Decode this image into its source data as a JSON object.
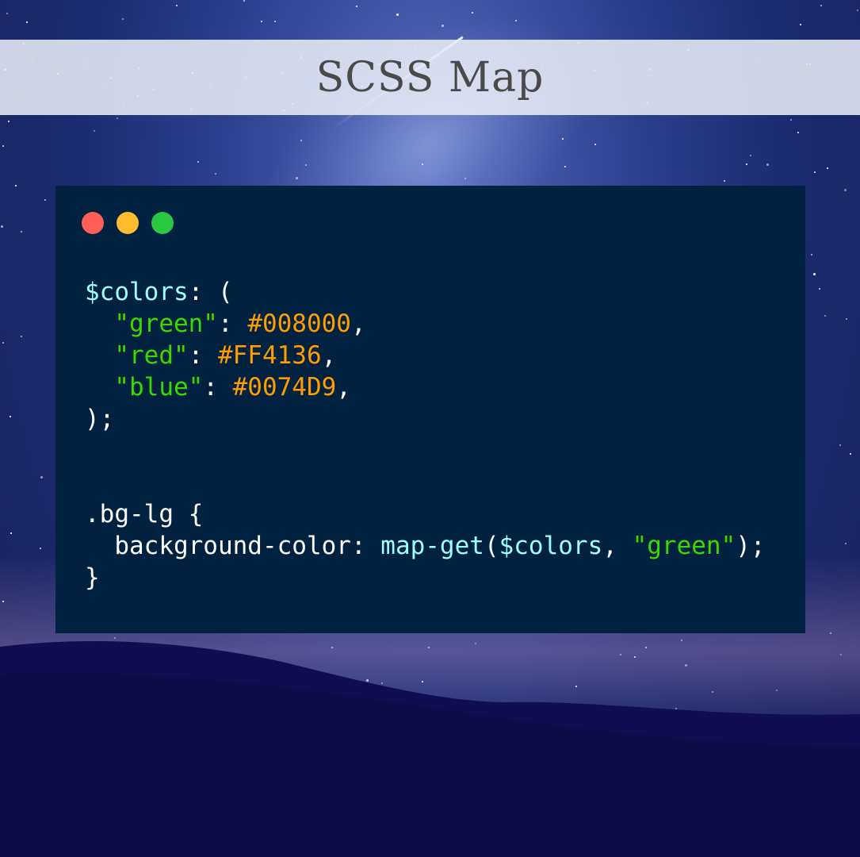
{
  "title": "SCSS Map",
  "window_controls": {
    "close_color": "#ff5f57",
    "minimize_color": "#febc2e",
    "maximize_color": "#28c840"
  },
  "colors": {
    "code_bg": "#002240",
    "plain": "#ffffff",
    "variable": "#9effff",
    "string": "#3ad900",
    "value": "#ff9d00"
  },
  "code_lines": [
    [
      {
        "t": "$colors",
        "c": "variable"
      },
      {
        "t": ": (",
        "c": "plain"
      }
    ],
    [
      {
        "t": "  ",
        "c": "plain"
      },
      {
        "t": "\"green\"",
        "c": "string"
      },
      {
        "t": ": ",
        "c": "plain"
      },
      {
        "t": "#008000",
        "c": "value"
      },
      {
        "t": ",",
        "c": "plain"
      }
    ],
    [
      {
        "t": "  ",
        "c": "plain"
      },
      {
        "t": "\"red\"",
        "c": "string"
      },
      {
        "t": ": ",
        "c": "plain"
      },
      {
        "t": "#FF4136",
        "c": "value"
      },
      {
        "t": ",",
        "c": "plain"
      }
    ],
    [
      {
        "t": "  ",
        "c": "plain"
      },
      {
        "t": "\"blue\"",
        "c": "string"
      },
      {
        "t": ": ",
        "c": "plain"
      },
      {
        "t": "#0074D9",
        "c": "value"
      },
      {
        "t": ",",
        "c": "plain"
      }
    ],
    [
      {
        "t": ");",
        "c": "plain"
      }
    ],
    [],
    [],
    [
      {
        "t": ".bg-lg {",
        "c": "plain"
      }
    ],
    [
      {
        "t": "  background-color: ",
        "c": "plain"
      },
      {
        "t": "map-get",
        "c": "variable"
      },
      {
        "t": "(",
        "c": "plain"
      },
      {
        "t": "$colors",
        "c": "variable"
      },
      {
        "t": ", ",
        "c": "plain"
      },
      {
        "t": "\"green\"",
        "c": "string"
      },
      {
        "t": ");",
        "c": "plain"
      }
    ],
    [
      {
        "t": "}",
        "c": "plain"
      }
    ]
  ]
}
